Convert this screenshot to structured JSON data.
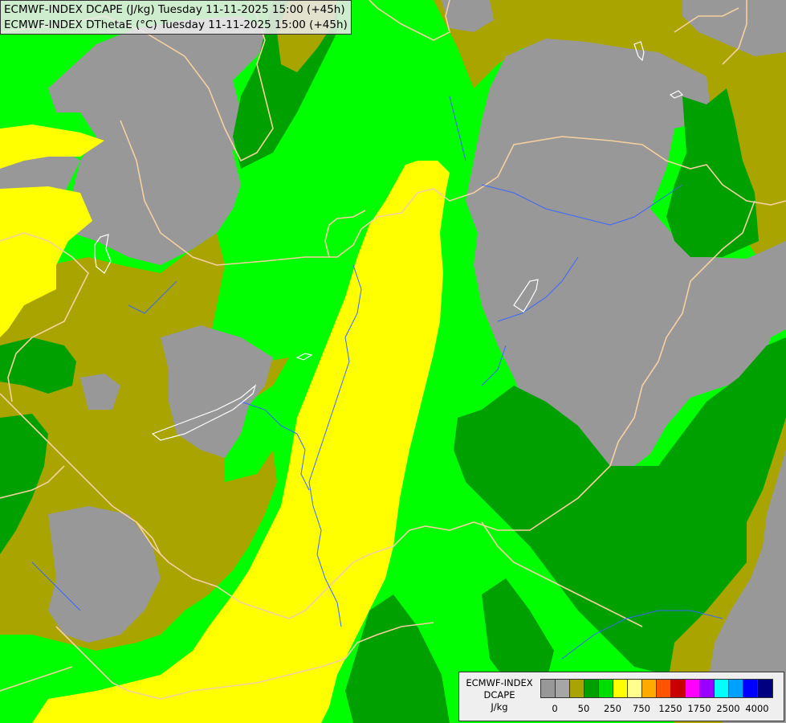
{
  "header": {
    "line1": "ECMWF-INDEX DCAPE (J/kg) Tuesday 11-11-2025 15:00 (+45h)",
    "line2": "ECMWF-INDEX DThetaE (°C) Tuesday 11-11-2025 15:00 (+45h)"
  },
  "legend": {
    "model": "ECMWF-INDEX",
    "field": "DCAPE",
    "unit": "J/kg",
    "colors": [
      "#989898",
      "#a6a6a6",
      "#a9a400",
      "#00a000",
      "#00dd00",
      "#ffff00",
      "#ffff90",
      "#ffaa00",
      "#ff5500",
      "#c80000",
      "#ff00ff",
      "#9900ff",
      "#00ffff",
      "#00a0ff",
      "#0000ff",
      "#000080"
    ],
    "tick_labels": [
      "0",
      "50",
      "250",
      "750",
      "1250",
      "1750",
      "2500",
      "4000"
    ]
  },
  "map_colors": {
    "grey": "#989898",
    "olive": "#a9a400",
    "dark_green": "#00a000",
    "green": "#00ff00",
    "yellow": "#ffff00",
    "border": "#f5d0a0",
    "river": "#3a66ff",
    "lake_outline": "#ffffff"
  }
}
